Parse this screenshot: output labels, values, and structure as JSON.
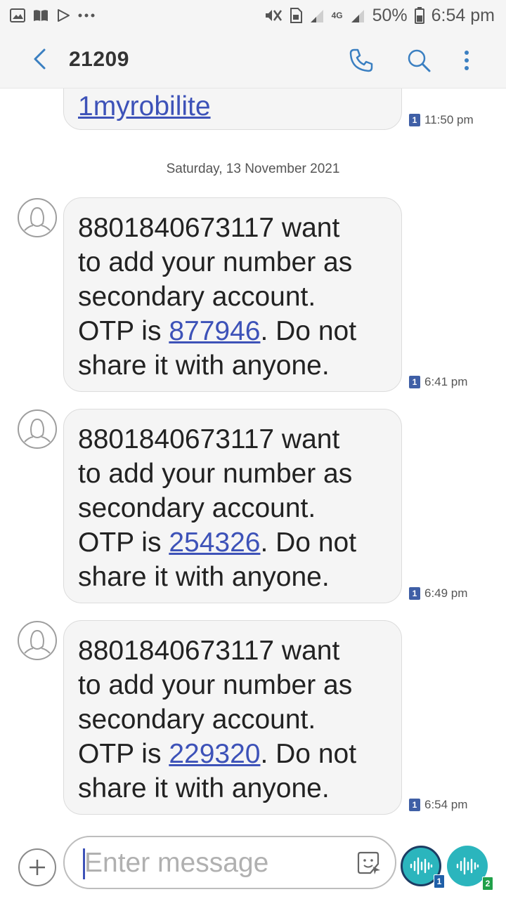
{
  "status_bar": {
    "battery_percent": "50%",
    "time": "6:54 pm",
    "network_label": "4G"
  },
  "header": {
    "title": "21209"
  },
  "previous_message": {
    "link_text": "1myrobilite",
    "time": "11:50 pm",
    "sim": "1"
  },
  "date_separator": "Saturday, 13 November 2021",
  "messages": [
    {
      "line1": "8801840673117 want",
      "line2": "to add your number as",
      "line3": "secondary account.",
      "otp_prefix": "OTP is ",
      "otp": "877946",
      "otp_suffix": ". Do not",
      "line5": "share it with anyone.",
      "time": "6:41 pm",
      "sim": "1"
    },
    {
      "line1": "8801840673117 want",
      "line2": "to add your number as",
      "line3": "secondary account.",
      "otp_prefix": "OTP is ",
      "otp": "254326",
      "otp_suffix": ". Do not",
      "line5": "share it with anyone.",
      "time": "6:49 pm",
      "sim": "1"
    },
    {
      "line1": "8801840673117 want",
      "line2": "to add your number as",
      "line3": "secondary account.",
      "otp_prefix": "OTP is ",
      "otp": "229320",
      "otp_suffix": ". Do not",
      "line5": "share it with anyone.",
      "time": "6:54 pm",
      "sim": "1"
    }
  ],
  "composer": {
    "placeholder": "Enter message",
    "send_sim_1": "1",
    "send_sim_2": "2"
  },
  "icons": {
    "back": "chevron-left-icon",
    "call": "phone-icon",
    "search": "search-icon",
    "more": "more-vertical-icon",
    "avatar": "person-outline-icon",
    "add": "plus-icon",
    "sticker": "sticker-icon",
    "send": "voice-wave-icon"
  },
  "colors": {
    "accent": "#3d52b8",
    "icon_blue": "#3a7fc1",
    "send_teal": "#2bb5bd",
    "sim1": "#1f5fa8",
    "sim2": "#21a04a",
    "bubble_bg": "#f5f5f5"
  }
}
